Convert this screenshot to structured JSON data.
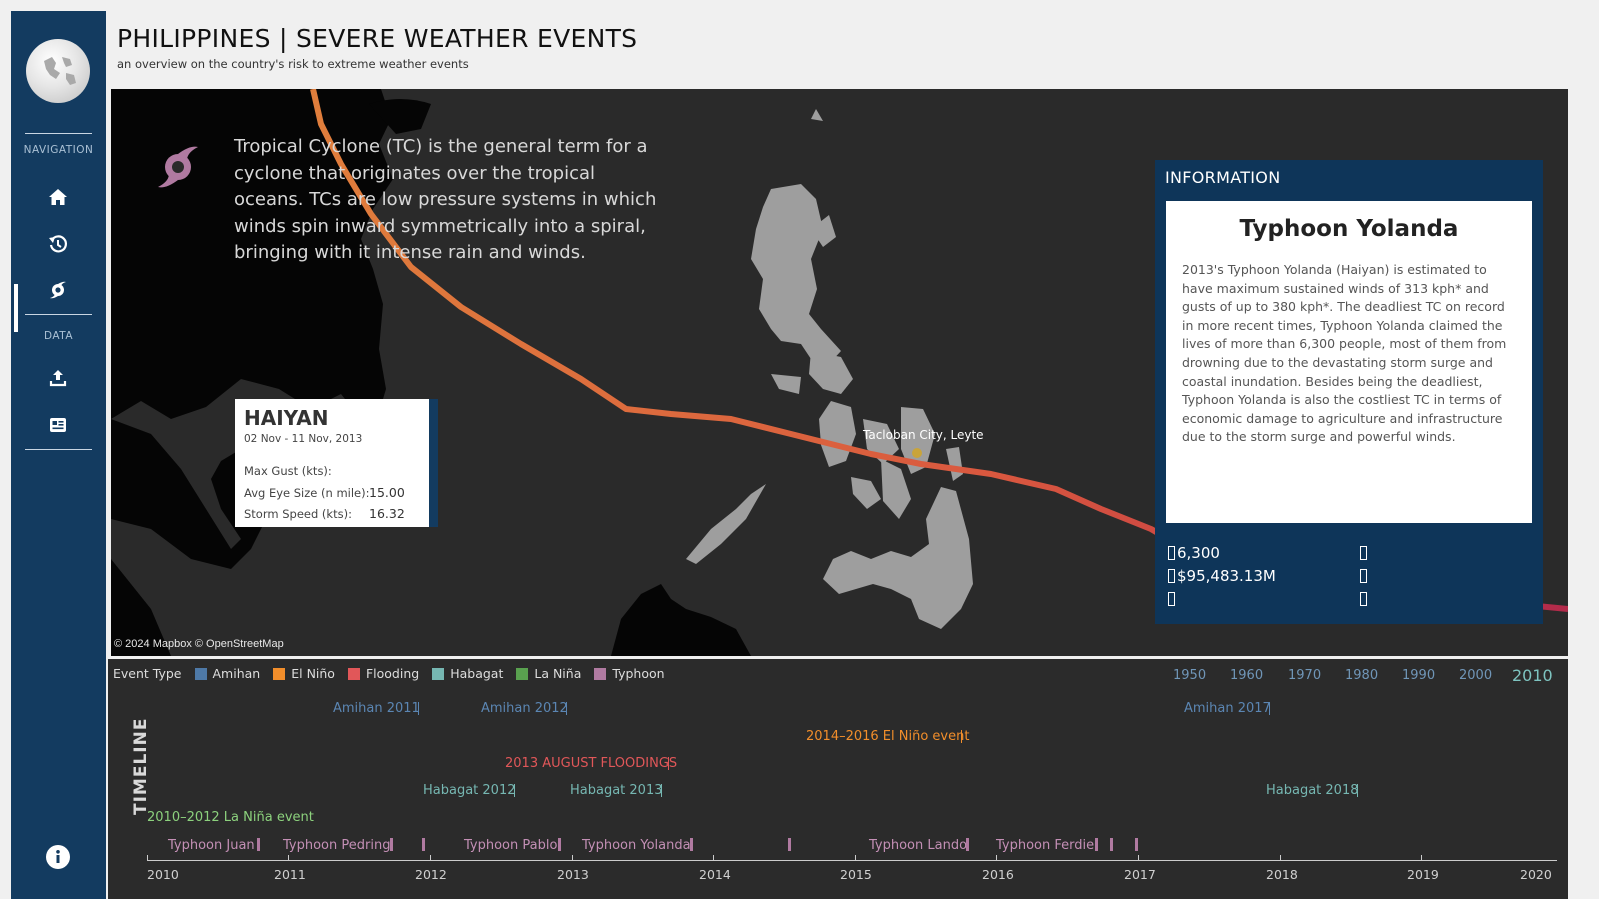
{
  "header": {
    "title": "PHILIPPINES | SEVERE WEATHER EVENTS",
    "subtitle": "an overview on the country's risk to extreme weather events"
  },
  "sidebar": {
    "sections": [
      "NAVIGATION",
      "DATA"
    ],
    "nav_items": [
      {
        "icon": "home-icon",
        "active": false
      },
      {
        "icon": "history-icon",
        "active": false
      },
      {
        "icon": "cyclone-icon",
        "active": true
      }
    ],
    "data_items": [
      {
        "icon": "upload-icon"
      },
      {
        "icon": "news-icon"
      }
    ],
    "footer_icon": "info-icon"
  },
  "map": {
    "description": "Tropical Cyclone (TC) is the general term for a cyclone that originates over the tropical oceans. TCs are low pressure systems in which winds spin inward symmetrically into a spiral, bringing with it intense rain and winds.",
    "city_label": "Tacloban City, Leyte",
    "attribution": "© 2024 Mapbox © OpenStreetMap",
    "track_colors": [
      "#e07e3c",
      "#d9573f",
      "#b22a4a"
    ]
  },
  "tooltip": {
    "name": "HAIYAN",
    "dates": "02 Nov - 11 Nov, 2013",
    "rows": [
      {
        "label": "Max Gust (kts):",
        "value": ""
      },
      {
        "label": "Avg Eye Size (n mile):",
        "value": "15.00"
      },
      {
        "label": "Storm Speed (kts):",
        "value": "16.32"
      }
    ]
  },
  "info": {
    "heading": "INFORMATION",
    "title": "Typhoon Yolanda",
    "body": "2013's Typhoon Yolanda (Haiyan) is estimated to have maximum sustained winds of 313 kph* and gusts of up to 380 kph*. The deadliest TC on record in more recent times, Typhoon Yolanda claimed the lives of more than 6,300 people, most of them from drowning due to the devastating storm surge and coastal inundation. Besides being the deadliest, Typhoon Yolanda is also the costliest TC in terms of economic damage to agriculture and infrastructure due to the storm surge and powerful winds.",
    "stats": {
      "deaths": "6,300",
      "damage": "$95,483.13M",
      "third": ""
    }
  },
  "legend": {
    "label": "Event Type",
    "items": [
      {
        "name": "Amihan",
        "color": "#4e79a7"
      },
      {
        "name": "El Niño",
        "color": "#f28e2b"
      },
      {
        "name": "Flooding",
        "color": "#e15759"
      },
      {
        "name": "Habagat",
        "color": "#76b7b2"
      },
      {
        "name": "La Niña",
        "color": "#59a14f"
      },
      {
        "name": "Typhoon",
        "color": "#b07aa1"
      }
    ]
  },
  "decades": [
    "1950",
    "1960",
    "1970",
    "1980",
    "1990",
    "2000",
    "2010"
  ],
  "active_decade": "2010",
  "timeline": {
    "label": "TIMELINE",
    "events": [
      {
        "name": "Amihan 2011",
        "color": "#5b86b3"
      },
      {
        "name": "Amihan 2012",
        "color": "#5b86b3"
      },
      {
        "name": "Amihan 2017",
        "color": "#5b86b3"
      },
      {
        "name": "2014–2016 El Niño event",
        "color": "#f28e2b"
      },
      {
        "name": "2013 AUGUST FLOODINGS",
        "color": "#e15759"
      },
      {
        "name": "Habagat 2012",
        "color": "#76b7b2"
      },
      {
        "name": "Habagat 2013",
        "color": "#76b7b2"
      },
      {
        "name": "Habagat 2018",
        "color": "#76b7b2"
      },
      {
        "name": "2010–2012 La Niña event",
        "color": "#8cd17d"
      },
      {
        "name": "Typhoon Juan",
        "color": "#c38fb5"
      },
      {
        "name": "Typhoon Pedring",
        "color": "#c38fb5"
      },
      {
        "name": "Typhoon Pablo",
        "color": "#c38fb5"
      },
      {
        "name": "Typhoon Yolanda",
        "color": "#c38fb5"
      },
      {
        "name": "Typhoon Lando",
        "color": "#c38fb5"
      },
      {
        "name": "Typhoon Ferdie",
        "color": "#c38fb5"
      }
    ],
    "years": [
      "2010",
      "2011",
      "2012",
      "2013",
      "2014",
      "2015",
      "2016",
      "2017",
      "2018",
      "2019",
      "2020"
    ]
  }
}
